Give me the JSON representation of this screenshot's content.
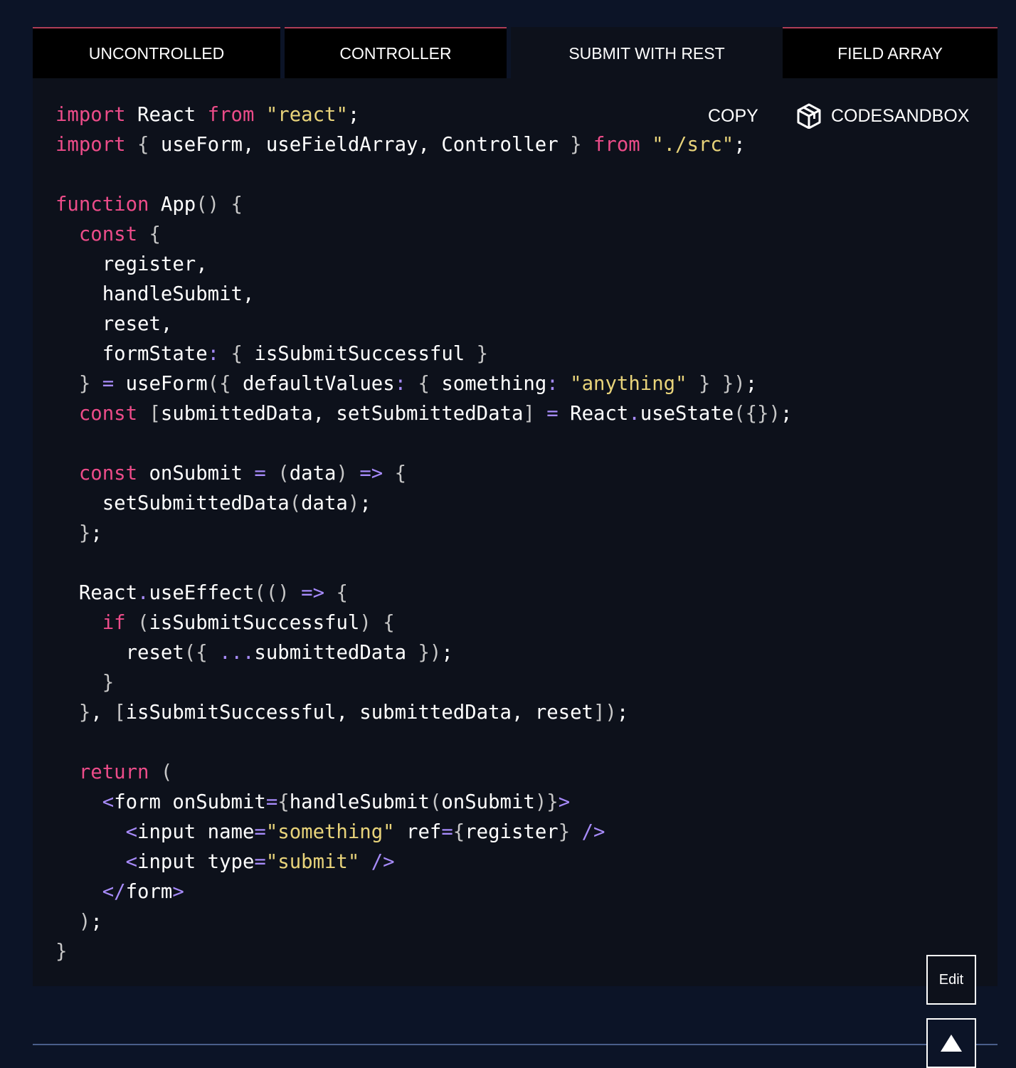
{
  "tabs": [
    {
      "label": "UNCONTROLLED",
      "active": false
    },
    {
      "label": "CONTROLLER",
      "active": false
    },
    {
      "label": "SUBMIT WITH REST",
      "active": true
    },
    {
      "label": "FIELD ARRAY",
      "active": false
    }
  ],
  "toolbar": {
    "copy_label": "COPY",
    "codesandbox_label": "CODESANDBOX",
    "codesandbox_icon": "codesandbox-cube-icon"
  },
  "code": {
    "language": "jsx",
    "lines": [
      "import React from \"react\";",
      "import { useForm, useFieldArray, Controller } from \"./src\";",
      "",
      "function App() {",
      "  const {",
      "    register,",
      "    handleSubmit,",
      "    reset,",
      "    formState: { isSubmitSuccessful }",
      "  } = useForm({ defaultValues: { something: \"anything\" } });",
      "  const [submittedData, setSubmittedData] = React.useState({});",
      "",
      "  const onSubmit = (data) => {",
      "    setSubmittedData(data);",
      "  };",
      "",
      "  React.useEffect(() => {",
      "    if (isSubmitSuccessful) {",
      "      reset({ ...submittedData });",
      "    }",
      "  }, [isSubmitSuccessful, submittedData, reset]);",
      "",
      "  return (",
      "    <form onSubmit={handleSubmit(onSubmit)}>",
      "      <input name=\"something\" ref={register} />",
      "      <input type=\"submit\" />",
      "    </form>",
      "  );",
      "}"
    ]
  },
  "edit_button": {
    "label": "Edit"
  },
  "scroll_top_button": {
    "icon": "triangle-up-icon"
  },
  "colors": {
    "page_bg": "#0c1427",
    "code_bg": "#0d111b",
    "tab_bg": "#000000",
    "tab_border": "#ae3d57",
    "keyword": "#ec4c89",
    "string": "#e8d37a",
    "operator": "#a78bfa",
    "text": "#ffffff"
  }
}
